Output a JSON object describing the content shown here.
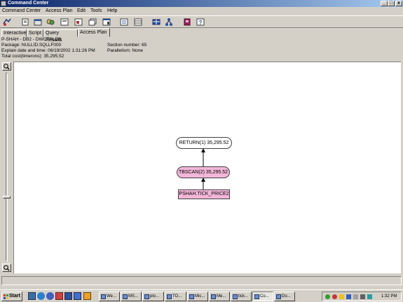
{
  "window": {
    "title": "Command Center",
    "caption_buttons": {
      "minimize": "_",
      "maximize": "□",
      "close": "x"
    }
  },
  "menu": [
    "Command Center",
    "Access Plan",
    "Edit",
    "Tools",
    "Help"
  ],
  "toolbar_icons": [
    "command-center-icon",
    "script-center-icon",
    "query-icon",
    "journal-icon",
    "license-icon",
    "window-icon",
    "restore-icon",
    "sql-icon",
    "plan-icon",
    "grid-icon",
    "tree-icon",
    "book-icon",
    "help-icon"
  ],
  "tabs": [
    "Interactive",
    "Script",
    "Query Results",
    "Access Plan"
  ],
  "active_tab": "Access Plan",
  "plan_info": {
    "database": "P-SHAH - DB2 - DWCTRLDB",
    "package": "Package: NULLID.SQLLF000",
    "section": "Section number: 65",
    "explained": "Explain date and time: 06/19/2002 1:31:26 PM",
    "parallelism": "Parallelism: None",
    "total_cost": "Total cost(timerons): 35,295.52"
  },
  "plan_graph": {
    "nodes": [
      {
        "id": "return",
        "label": "RETURN(1) 35,295.52",
        "fill": "#ffffff",
        "shape": "rounded"
      },
      {
        "id": "tbscan",
        "label": "TBSCAN(2) 35,295.52",
        "fill": "#f3b5d8",
        "shape": "rounded"
      },
      {
        "id": "table",
        "label": "PSHAH.TICK_PRICE2",
        "fill": "#f3b5d8",
        "shape": "rectangle"
      }
    ],
    "edges": [
      {
        "from": "table",
        "to": "tbscan"
      },
      {
        "from": "tbscan",
        "to": "return"
      }
    ]
  },
  "zoom": {
    "level": 0.35
  },
  "taskbar": {
    "start_label": "Start",
    "quick_launch": [
      "desktop-icon",
      "ie-icon",
      "outlook-icon",
      "media-icon",
      "app-icon",
      "app2-icon",
      "winamp-icon"
    ],
    "tasks": [
      {
        "label": "We...",
        "active": false
      },
      {
        "label": "MS...",
        "active": false
      },
      {
        "label": "plo...",
        "active": false
      },
      {
        "label": "TO...",
        "active": false
      },
      {
        "label": "Mic...",
        "active": false
      },
      {
        "label": "Me...",
        "active": false
      },
      {
        "label": "tick...",
        "active": false
      },
      {
        "label": "Co...",
        "active": true
      },
      {
        "label": "Do...",
        "active": false
      }
    ],
    "clock": "1:32 PM"
  }
}
